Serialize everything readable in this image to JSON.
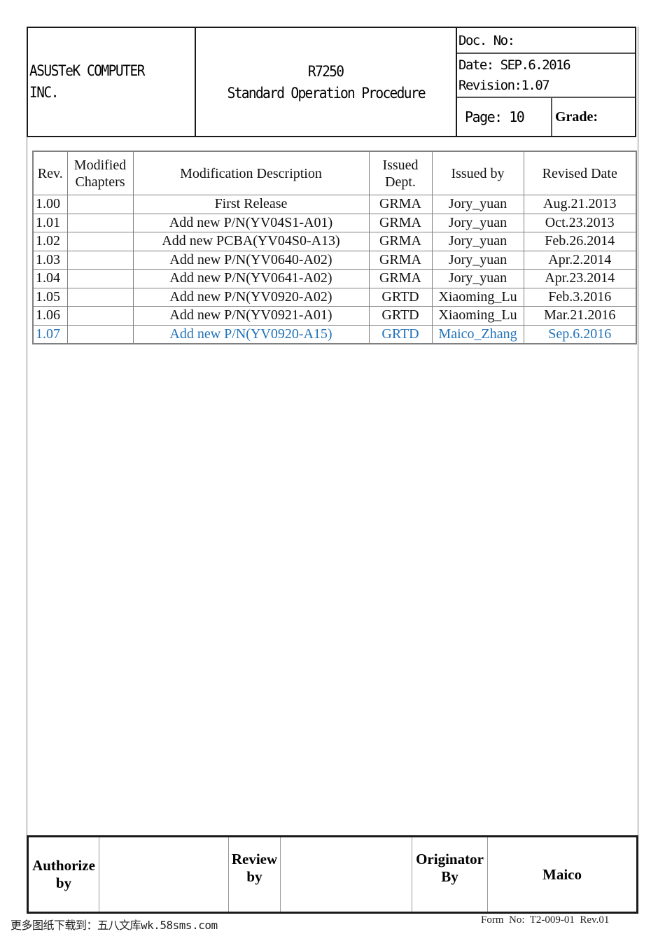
{
  "header": {
    "company_line1": "ASUSTeK COMPUTER",
    "company_line2": "INC.",
    "model": "R7250",
    "doc_title": "Standard Operation Procedure",
    "doc_no_label": "Doc. No:",
    "date_label": "Date: SEP.6.2016",
    "revision_label": "Revision:1.07",
    "page_label": "Page: 10",
    "grade_label": "Grade:"
  },
  "revision_table": {
    "columns": [
      "Rev.",
      "Modified Chapters",
      "Modification Description",
      "Issued Dept.",
      "Issued by",
      "Revised Date"
    ],
    "columns_multiline": {
      "modified_chapters": [
        "Modified",
        "Chapters"
      ],
      "issued_dept": [
        "Issued",
        "Dept."
      ]
    },
    "rows": [
      {
        "rev": "1.00",
        "chapters": "",
        "description": "First Release",
        "dept": "GRMA",
        "issued_by": "Jory_yuan",
        "date": "Aug.21.2013"
      },
      {
        "rev": "1.01",
        "chapters": "",
        "description": "Add new P/N(YV04S1-A01)",
        "dept": "GRMA",
        "issued_by": "Jory_yuan",
        "date": "Oct.23.2013"
      },
      {
        "rev": "1.02",
        "chapters": "",
        "description": "Add new PCBA(YV04S0-A13)",
        "dept": "GRMA",
        "issued_by": "Jory_yuan",
        "date": "Feb.26.2014"
      },
      {
        "rev": "1.03",
        "chapters": "",
        "description": "Add new P/N(YV0640-A02)",
        "dept": "GRMA",
        "issued_by": "Jory_yuan",
        "date": "Apr.2.2014"
      },
      {
        "rev": "1.04",
        "chapters": "",
        "description": "Add new P/N(YV0641-A02)",
        "dept": "GRMA",
        "issued_by": "Jory_yuan",
        "date": "Apr.23.2014"
      },
      {
        "rev": "1.05",
        "chapters": "",
        "description": "Add new P/N(YV0920-A02)",
        "dept": "GRTD",
        "issued_by": "Xiaoming_Lu",
        "date": "Feb.3.2016"
      },
      {
        "rev": "1.06",
        "chapters": "",
        "description": "Add new P/N(YV0921-A01)",
        "dept": "GRTD",
        "issued_by": "Xiaoming_Lu",
        "date": "Mar.21.2016"
      },
      {
        "rev": "1.07",
        "chapters": "",
        "description": "Add new P/N(YV0920-A15)",
        "dept": "GRTD",
        "issued_by": "Maico_Zhang",
        "date": "Sep.6.2016"
      }
    ],
    "latest_row_color": "#2272b8"
  },
  "signoff": {
    "authorize_label": [
      "Authorize",
      "by"
    ],
    "authorize_value": "",
    "review_label": [
      "Review",
      "by"
    ],
    "review_value": "",
    "originator_label": [
      "Originator",
      "By"
    ],
    "originator_value": "Maico"
  },
  "footer": {
    "watermark": "更多图纸下载到：五八文库wk.58sms.com",
    "form_no": "Form  No:  T2-009-01  Rev.01"
  }
}
